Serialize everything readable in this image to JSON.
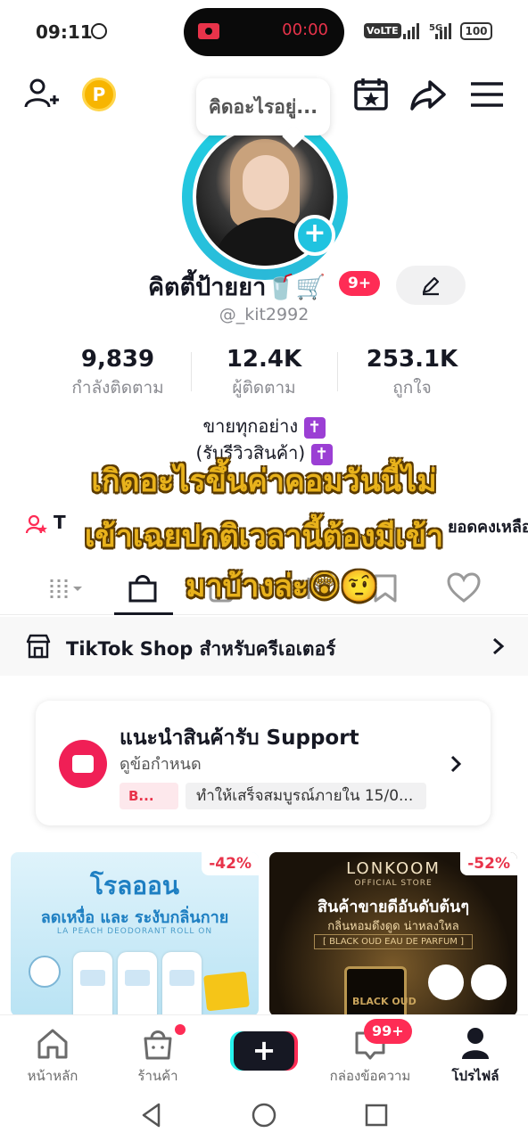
{
  "status_bar": {
    "time": "09:11",
    "recording_time": "00:00",
    "volte_label": "VoLTE",
    "network_label": "5G",
    "battery": "100"
  },
  "header": {
    "coin_letter": "P",
    "thought_bubble": "คิดอะไรอยู่..."
  },
  "profile": {
    "display_name": "คิตตี้ป้ายยา🥤🛒",
    "notification_badge": "9+",
    "username": "@_kit2992",
    "stats": [
      {
        "value": "9,839",
        "label": "กำลังติดตาม"
      },
      {
        "value": "12.4K",
        "label": "ผู้ติดตาม"
      },
      {
        "value": "253.1K",
        "label": "ถูกใจ"
      }
    ],
    "bio_line1": "ขายทุกอย่าง",
    "bio_line2": "(รับรีวิวสินค้า)",
    "link_left": "T",
    "link_right": "ยอดคงเหลือ"
  },
  "caption": {
    "line1": "เกิดอะไรขึ้นค่าคอมวันนี้ไม่",
    "line2": "เข้าเฉยปกติเวลานี้ต้องมีเข้า",
    "line3": "มาบ้างล่ะ😲🤨"
  },
  "shop_bar": {
    "label": "TikTok Shop สำหรับครีเอเตอร์"
  },
  "support_card": {
    "title": "แนะนำสินค้ารับ Support",
    "subtitle": "ดูข้อกำหนด",
    "chip_short": "B...",
    "chip_deadline": "ทำให้เสร็จสมบูรณ์ภายใน 15/0..."
  },
  "products": [
    {
      "discount": "-42%",
      "title": "โรลออน",
      "subtitle": "ลดเหงื่อ และ ระงับกลิ่นกาย",
      "english": "LA PEACH DEODORANT ROLL ON"
    },
    {
      "discount": "-52%",
      "brand": "LONKOOM",
      "store": "OFFICIAL STORE",
      "title": "สินค้าขายดีอันดับต้นๆ",
      "subtitle": "กลิ่นหอมดึงดูด น่าหลงใหล",
      "tag": "[ BLACK OUD EAU DE PARFUM ]",
      "bottle_label": "BLACK OUD"
    }
  ],
  "bottom_nav": {
    "items": [
      {
        "label": "หน้าหลัก",
        "icon": "home-icon"
      },
      {
        "label": "ร้านค้า",
        "icon": "shop-bag-icon"
      },
      {
        "label": "",
        "icon": "create-plus-icon"
      },
      {
        "label": "กล่องข้อความ",
        "icon": "inbox-icon"
      },
      {
        "label": "โปรไฟล์",
        "icon": "profile-icon"
      }
    ],
    "inbox_badge": "99+",
    "create_symbol": "+"
  },
  "colors": {
    "accent_red": "#fe2c55",
    "ring_cyan": "#20c3e0",
    "caption_gold": "#e8b21c"
  }
}
